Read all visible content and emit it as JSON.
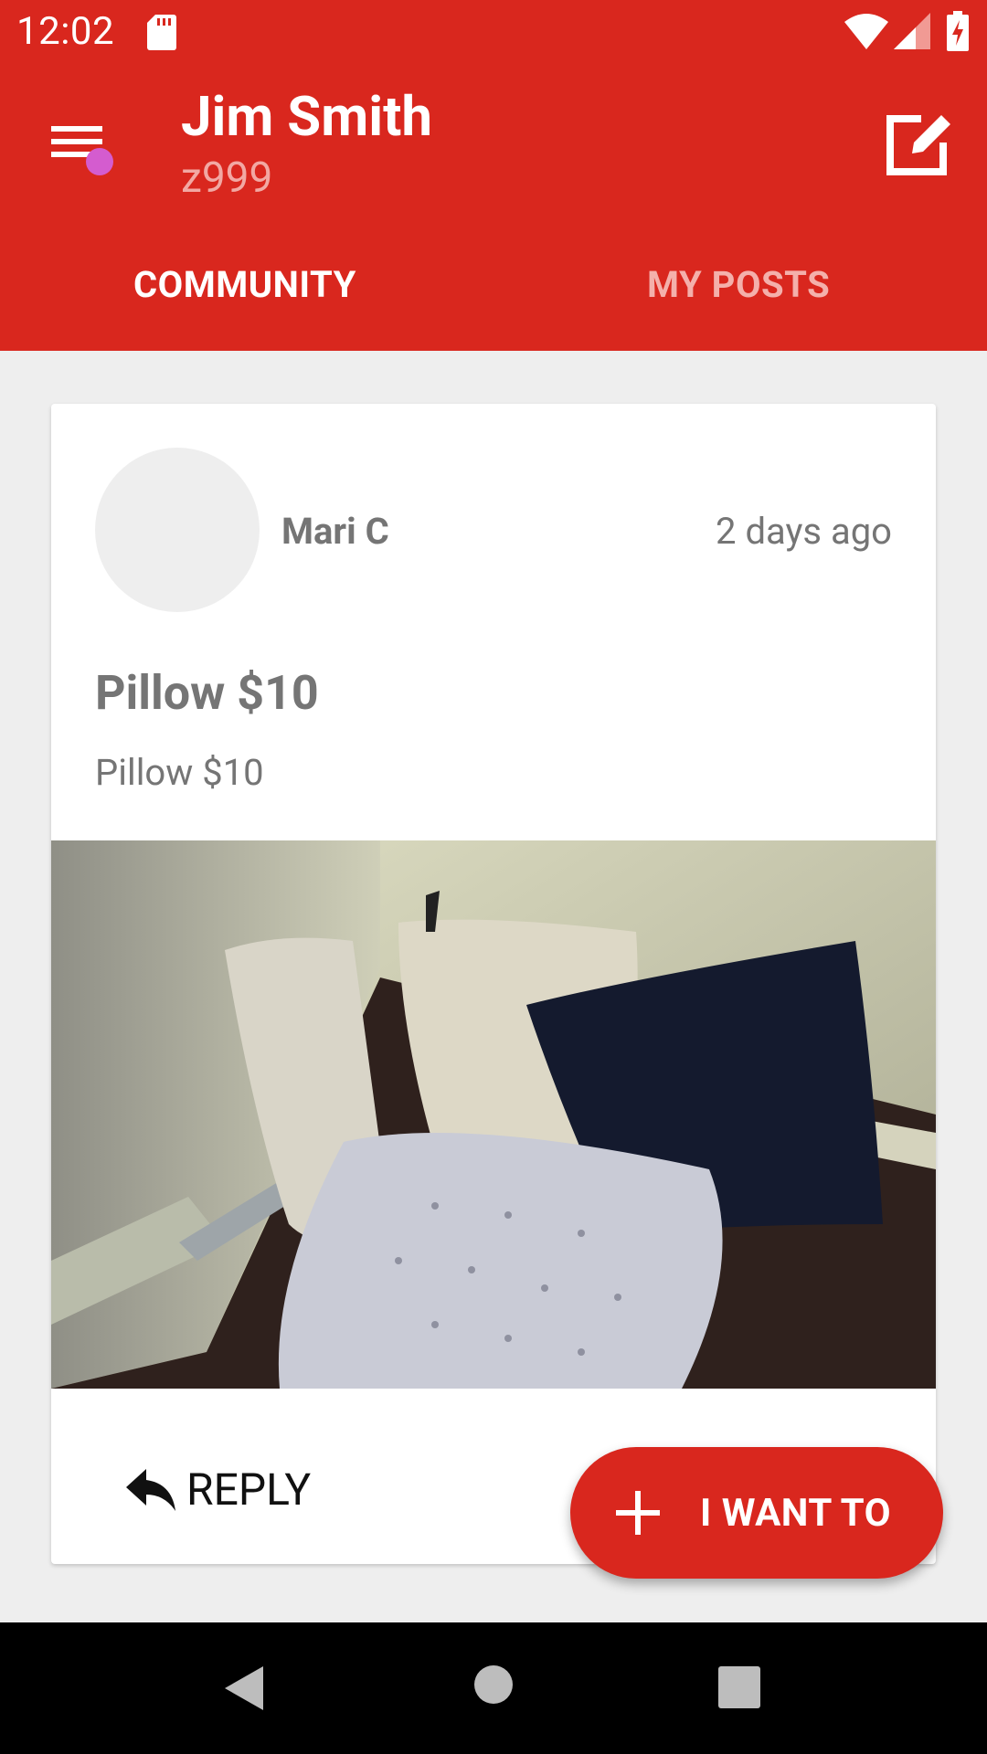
{
  "status_bar": {
    "time": "12:02",
    "icons": [
      "sd-card-icon",
      "wifi-icon",
      "cell-signal-icon",
      "battery-charging-icon"
    ]
  },
  "app_bar": {
    "user_name": "Jim Smith",
    "user_id": "z999",
    "menu_icon": "hamburger-menu-icon",
    "compose_icon": "compose-icon",
    "color": "#d9271e"
  },
  "tabs": [
    {
      "label": "COMMUNITY",
      "active": true
    },
    {
      "label": "MY POSTS",
      "active": false
    }
  ],
  "post": {
    "author": "Mari C",
    "timestamp": "2 days ago",
    "title": "Pillow $10",
    "body": "Pillow $10",
    "image_alt": "pillows in corner photo",
    "reply_label": "REPLY"
  },
  "fab": {
    "label": "I WANT TO",
    "icon": "plus-icon"
  },
  "nav_bar": {
    "icons": [
      "back-icon",
      "home-icon",
      "recents-icon"
    ]
  }
}
